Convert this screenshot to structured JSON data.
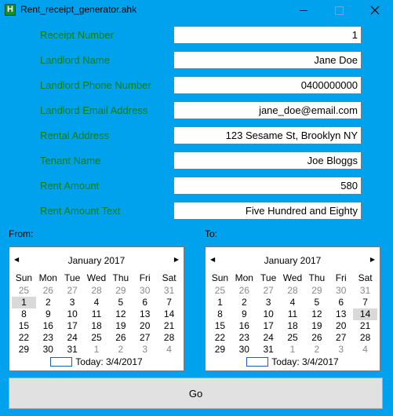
{
  "window": {
    "title": "Rent_receipt_generator.ahk",
    "icon_letter": "H"
  },
  "form": {
    "receipt_number_label": "Receipt Number",
    "receipt_number": "1",
    "landlord_name_label": "Landlord Name",
    "landlord_name": "Jane Doe",
    "landlord_phone_label": "Landlord Phone Number",
    "landlord_phone": "0400000000",
    "landlord_email_label": "Landlord Email Address",
    "landlord_email": "jane_doe@email.com",
    "rental_address_label": "Rental Address",
    "rental_address": "123 Sesame St, Brooklyn NY",
    "tenant_name_label": "Tenant Name",
    "tenant_name": "Joe Bloggs",
    "rent_amount_label": "Rent Amount",
    "rent_amount": "580",
    "rent_amount_text_label": "Rent Amount Text",
    "rent_amount_text": "Five Hundred and Eighty"
  },
  "range": {
    "from_label": "From:",
    "to_label": "To:"
  },
  "calendar_common": {
    "month": "January 2017",
    "weekdays": [
      "Sun",
      "Mon",
      "Tue",
      "Wed",
      "Thu",
      "Fri",
      "Sat"
    ],
    "weeks": [
      [
        "25",
        "26",
        "27",
        "28",
        "29",
        "30",
        "31"
      ],
      [
        "1",
        "2",
        "3",
        "4",
        "5",
        "6",
        "7"
      ],
      [
        "8",
        "9",
        "10",
        "11",
        "12",
        "13",
        "14"
      ],
      [
        "15",
        "16",
        "17",
        "18",
        "19",
        "20",
        "21"
      ],
      [
        "22",
        "23",
        "24",
        "25",
        "26",
        "27",
        "28"
      ],
      [
        "29",
        "30",
        "31",
        "1",
        "2",
        "3",
        "4"
      ]
    ],
    "today_label": "Today: 3/4/2017"
  },
  "calendar_from": {
    "selected_day": "1"
  },
  "calendar_to": {
    "selected_day": "14"
  },
  "go_label": "Go"
}
